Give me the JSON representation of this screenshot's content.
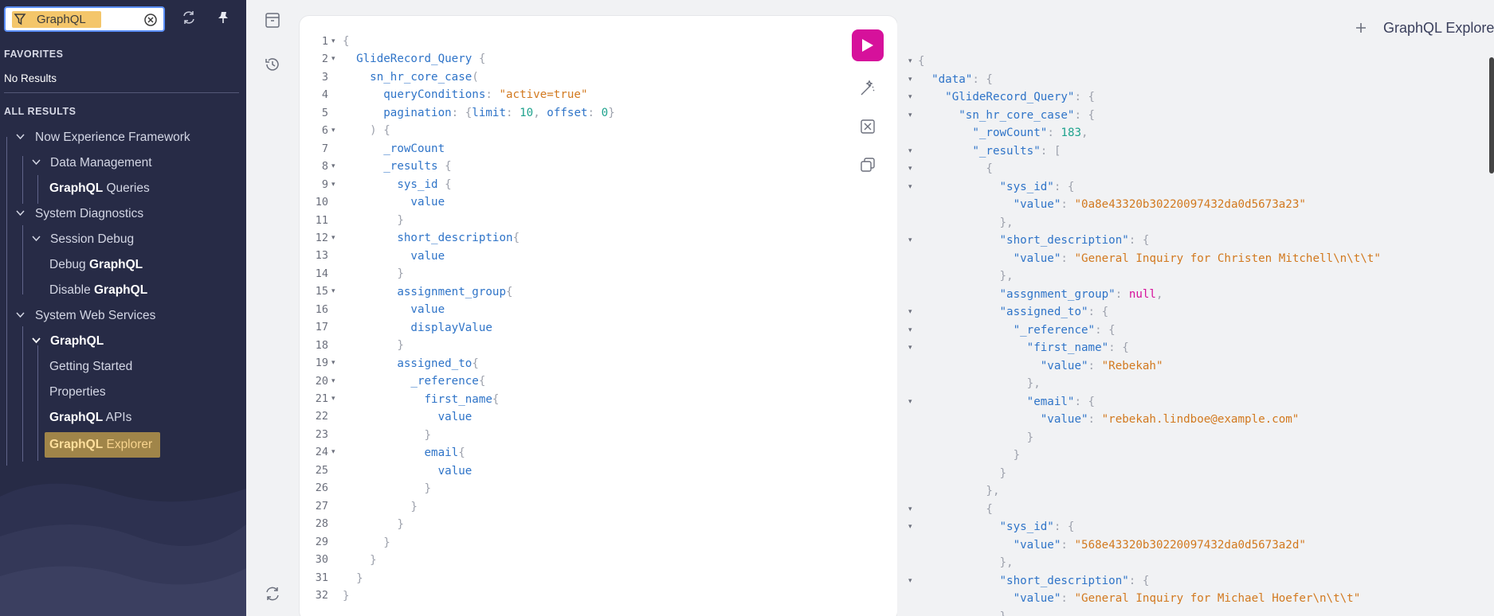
{
  "navigator": {
    "filter_value": "GraphQL",
    "favorites_heading": "FAVORITES",
    "favorites_empty": "No Results",
    "all_results_heading": "ALL RESULTS",
    "tree": {
      "item1": "Now Experience Framework",
      "item2": "Data Management",
      "item3_bold": "GraphQL",
      "item3_rest": " Queries",
      "item4": "System Diagnostics",
      "item5": "Session Debug",
      "item6_pre": "Debug ",
      "item6_bold": "GraphQL",
      "item7_pre": "Disable ",
      "item7_bold": "GraphQL",
      "item8": "System Web Services",
      "item9_bold": "GraphQL",
      "item10": "Getting Started",
      "item11": "Properties",
      "item12_bold": "GraphQL",
      "item12_rest": " APIs",
      "item13_bold": "GraphQL",
      "item13_rest": " Explorer"
    }
  },
  "tools": {
    "icons": [
      "archive-icon",
      "history-icon",
      "refresh-icon"
    ]
  },
  "editor": {
    "line_numbers": [
      "1",
      "2",
      "3",
      "4",
      "5",
      "6",
      "7",
      "8",
      "9",
      "10",
      "11",
      "12",
      "13",
      "14",
      "15",
      "16",
      "17",
      "18",
      "19",
      "20",
      "21",
      "22",
      "23",
      "24",
      "25",
      "26",
      "27",
      "28",
      "29",
      "30",
      "31",
      "32"
    ],
    "tokens": {
      "l2": "GlideRecord_Query",
      "l3": "sn_hr_core_case",
      "l4_key": "queryConditions",
      "l4_val": "\"active=true\"",
      "l5_key": "pagination",
      "l5_k1": "limit",
      "l5_v1": "10",
      "l5_k2": "offset",
      "l5_v2": "0",
      "l7": "_rowCount",
      "l8": "_results",
      "l9": "sys_id",
      "l10": "value",
      "l12": "short_description",
      "l13": "value",
      "l15": "assignment_group",
      "l16": "value",
      "l17": "displayValue",
      "l19": "assigned_to",
      "l20": "_reference",
      "l21": "first_name",
      "l22": "value",
      "l24": "email",
      "l25": "value"
    },
    "run_button_icon": "play-icon",
    "side_icons": [
      "prettify-icon",
      "merge-icon",
      "copy-icon"
    ]
  },
  "results": {
    "title": "GraphQL Explorer",
    "add_icon": "plus-icon",
    "json": {
      "data": "\"data\"",
      "query": "\"GlideRecord_Query\"",
      "table": "\"sn_hr_core_case\"",
      "rowcount_key": "\"_rowCount\"",
      "rowcount_val": "183",
      "results_key": "\"_results\"",
      "sysid_key": "\"sys_id\"",
      "value_key": "\"value\"",
      "sysid1": "\"0a8e43320b30220097432da0d5673a23\"",
      "shortdesc_key": "\"short_description\"",
      "shortdesc1": "\"General Inquiry for Christen Mitchell\\n\\t\\t\"",
      "assgroup_key": "\"assgnment_group\"",
      "null_val": "null",
      "assigned_key": "\"assigned_to\"",
      "reference_key": "\"_reference\"",
      "firstname_key": "\"first_name\"",
      "firstname1": "\"Rebekah\"",
      "email_key": "\"email\"",
      "email1": "\"rebekah.lindboe@example.com\"",
      "sysid2": "\"568e43320b30220097432da0d5673a2d\"",
      "shortdesc2": "\"General Inquiry for Michael Hoefer\\n\\t\\t\""
    }
  }
}
